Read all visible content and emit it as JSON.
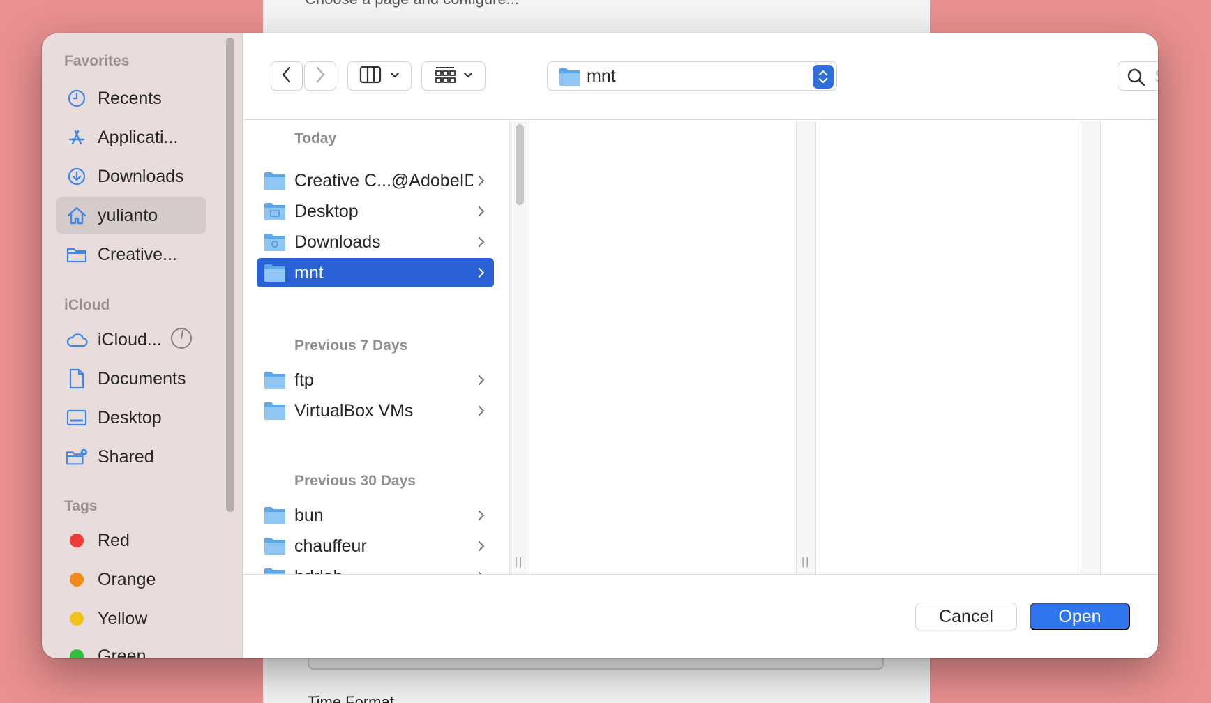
{
  "background": {
    "top_text": "Choose a page and configure...",
    "bottom_text": "Time Format"
  },
  "sidebar": {
    "favorites_title": "Favorites",
    "favorites": [
      {
        "label": "Recents",
        "icon": "clock-icon"
      },
      {
        "label": "Applicati...",
        "icon": "applications-icon"
      },
      {
        "label": "Downloads",
        "icon": "download-icon"
      },
      {
        "label": "yulianto",
        "icon": "home-icon",
        "selected": true
      },
      {
        "label": "Creative...",
        "icon": "folder-icon"
      }
    ],
    "icloud_title": "iCloud",
    "icloud": [
      {
        "label": "iCloud...",
        "icon": "cloud-icon"
      },
      {
        "label": "Documents",
        "icon": "document-icon"
      },
      {
        "label": "Desktop",
        "icon": "desktop-icon"
      },
      {
        "label": "Shared",
        "icon": "shared-folder-icon"
      }
    ],
    "tags_title": "Tags",
    "tags": [
      {
        "label": "Red",
        "color": "#ef3b36"
      },
      {
        "label": "Orange",
        "color": "#f08a1a"
      },
      {
        "label": "Yellow",
        "color": "#f0c21a"
      },
      {
        "label": "Green",
        "color": "#2fbf3a"
      }
    ]
  },
  "toolbar": {
    "path_label": "mnt",
    "search_placeholder": "Search"
  },
  "browser": {
    "groups": [
      {
        "title": "Today",
        "items": [
          {
            "label": "Creative C...@AdobeID"
          },
          {
            "label": "Desktop"
          },
          {
            "label": "Downloads"
          },
          {
            "label": "mnt",
            "selected": true
          }
        ]
      },
      {
        "title": "Previous 7 Days",
        "items": [
          {
            "label": "ftp"
          },
          {
            "label": "VirtualBox VMs"
          }
        ]
      },
      {
        "title": "Previous 30 Days",
        "items": [
          {
            "label": "bun"
          },
          {
            "label": "chauffeur"
          },
          {
            "label": "hdrlab"
          }
        ]
      }
    ]
  },
  "footer": {
    "cancel_label": "Cancel",
    "open_label": "Open"
  },
  "colors": {
    "accent": "#2f76ee",
    "selection": "#2a62d6",
    "sidebar_bg": "#e8dcdc",
    "backdrop": "#e99090"
  }
}
